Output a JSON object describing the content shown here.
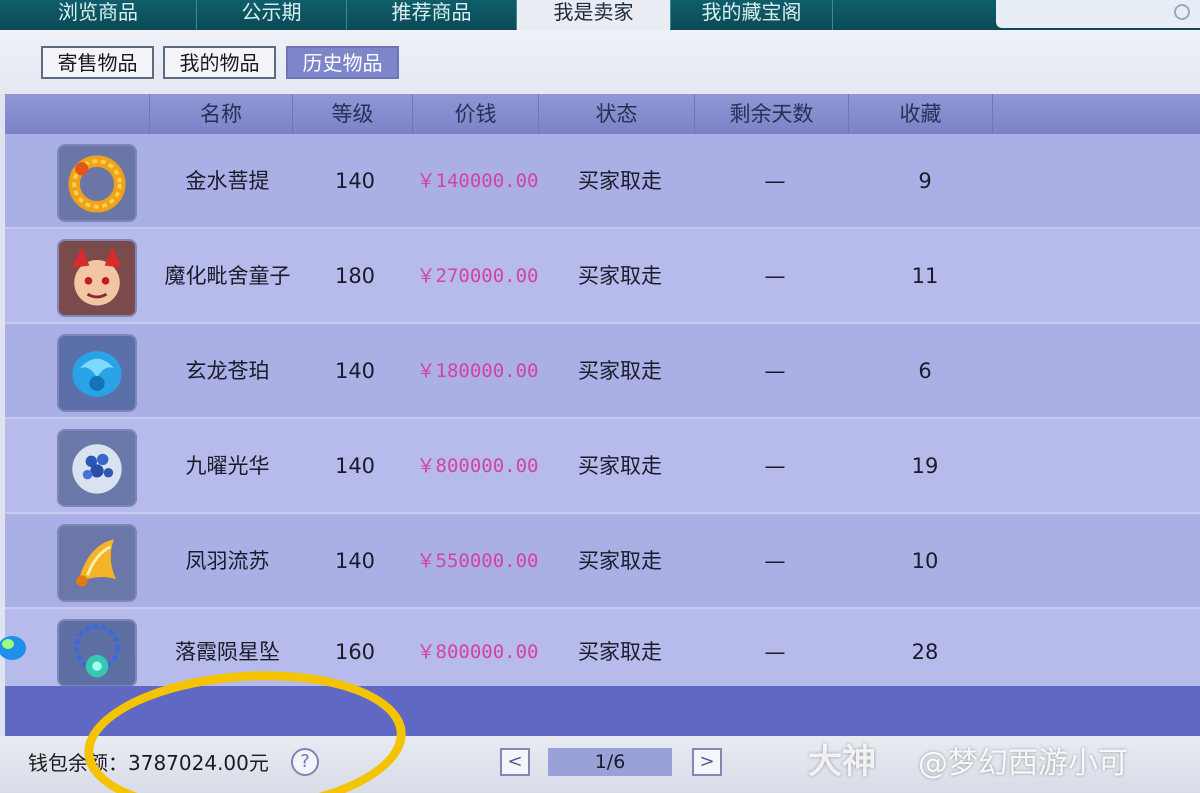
{
  "tabs": [
    {
      "label": "浏览商品",
      "active": false
    },
    {
      "label": "公示期",
      "active": false
    },
    {
      "label": "推荐商品",
      "active": false
    },
    {
      "label": "我是卖家",
      "active": true
    },
    {
      "label": "我的藏宝阁",
      "active": false
    }
  ],
  "subtabs": [
    {
      "label": "寄售物品",
      "active": false
    },
    {
      "label": "我的物品",
      "active": false
    },
    {
      "label": "历史物品",
      "active": true
    }
  ],
  "table": {
    "headers": [
      "名称",
      "等级",
      "价钱",
      "状态",
      "剩余天数",
      "收藏"
    ],
    "rows": [
      {
        "icon": "golden-dragon-ring-icon",
        "name": "金水菩提",
        "level": "140",
        "price": "￥140000.00",
        "status": "买家取走",
        "days": "—",
        "fav": "9"
      },
      {
        "icon": "demon-child-avatar-icon",
        "name": "魔化毗舍童子",
        "level": "180",
        "price": "￥270000.00",
        "status": "买家取走",
        "days": "—",
        "fav": "11"
      },
      {
        "icon": "blue-dragon-jade-icon",
        "name": "玄龙苍珀",
        "level": "140",
        "price": "￥180000.00",
        "status": "买家取走",
        "days": "—",
        "fav": "6"
      },
      {
        "icon": "pearl-cluster-icon",
        "name": "九曜光华",
        "level": "140",
        "price": "￥800000.00",
        "status": "买家取走",
        "days": "—",
        "fav": "19"
      },
      {
        "icon": "phoenix-tassel-icon",
        "name": "凤羽流苏",
        "level": "140",
        "price": "￥550000.00",
        "status": "买家取走",
        "days": "—",
        "fav": "10"
      },
      {
        "icon": "blue-chain-pendant-icon",
        "name": "落霞陨星坠",
        "level": "160",
        "price": "￥800000.00",
        "status": "买家取走",
        "days": "—",
        "fav": "28"
      }
    ]
  },
  "footer": {
    "wallet_label": "钱包余额：3787024.00元",
    "help": "?",
    "prev": "<",
    "next": ">",
    "page": "1/6"
  },
  "watermark": {
    "brand": "大神",
    "handle": "@梦幻西游小可"
  },
  "colors": {
    "tabbar": "#0d5562",
    "row_bg": "#aab0e6",
    "header_bg": "#8189cb",
    "price": "#d342a6",
    "highlight": "#f5c400"
  }
}
